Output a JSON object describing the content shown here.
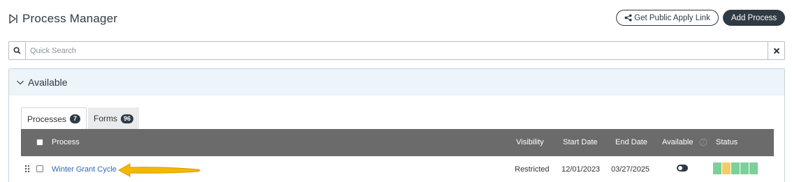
{
  "header": {
    "title": "Process Manager",
    "public_link_label": "Get Public Apply Link",
    "add_process_label": "Add Process"
  },
  "search": {
    "placeholder": "Quick Search",
    "value": ""
  },
  "panel": {
    "title": "Available",
    "tabs": [
      {
        "label": "Processes",
        "count": "7"
      },
      {
        "label": "Forms",
        "count": "96"
      }
    ],
    "columns": {
      "process": "Process",
      "visibility": "Visibility",
      "start_date": "Start Date",
      "end_date": "End Date",
      "available": "Available",
      "status": "Status"
    },
    "rows": [
      {
        "process": "Winter Grant Cycle",
        "visibility": "Restricted",
        "start_date": "12/01/2023",
        "end_date": "03/27/2025",
        "status_colors": [
          "#7ed09a",
          "#f2cc6b",
          "#7ed09a",
          "#7ed09a",
          "#7ed09a"
        ]
      }
    ]
  },
  "colors": {
    "primary_dark": "#2f3a44",
    "link": "#2a6bb5",
    "table_header": "#6b6b6b",
    "panel_header": "#edf4fa",
    "annotation_arrow": "#f5b800"
  },
  "icons": [
    "play-bracket-icon",
    "share-icon",
    "search-icon",
    "close-icon",
    "chevron-down-icon",
    "help-icon",
    "drag-handle-icon",
    "annotation-arrow-icon"
  ]
}
